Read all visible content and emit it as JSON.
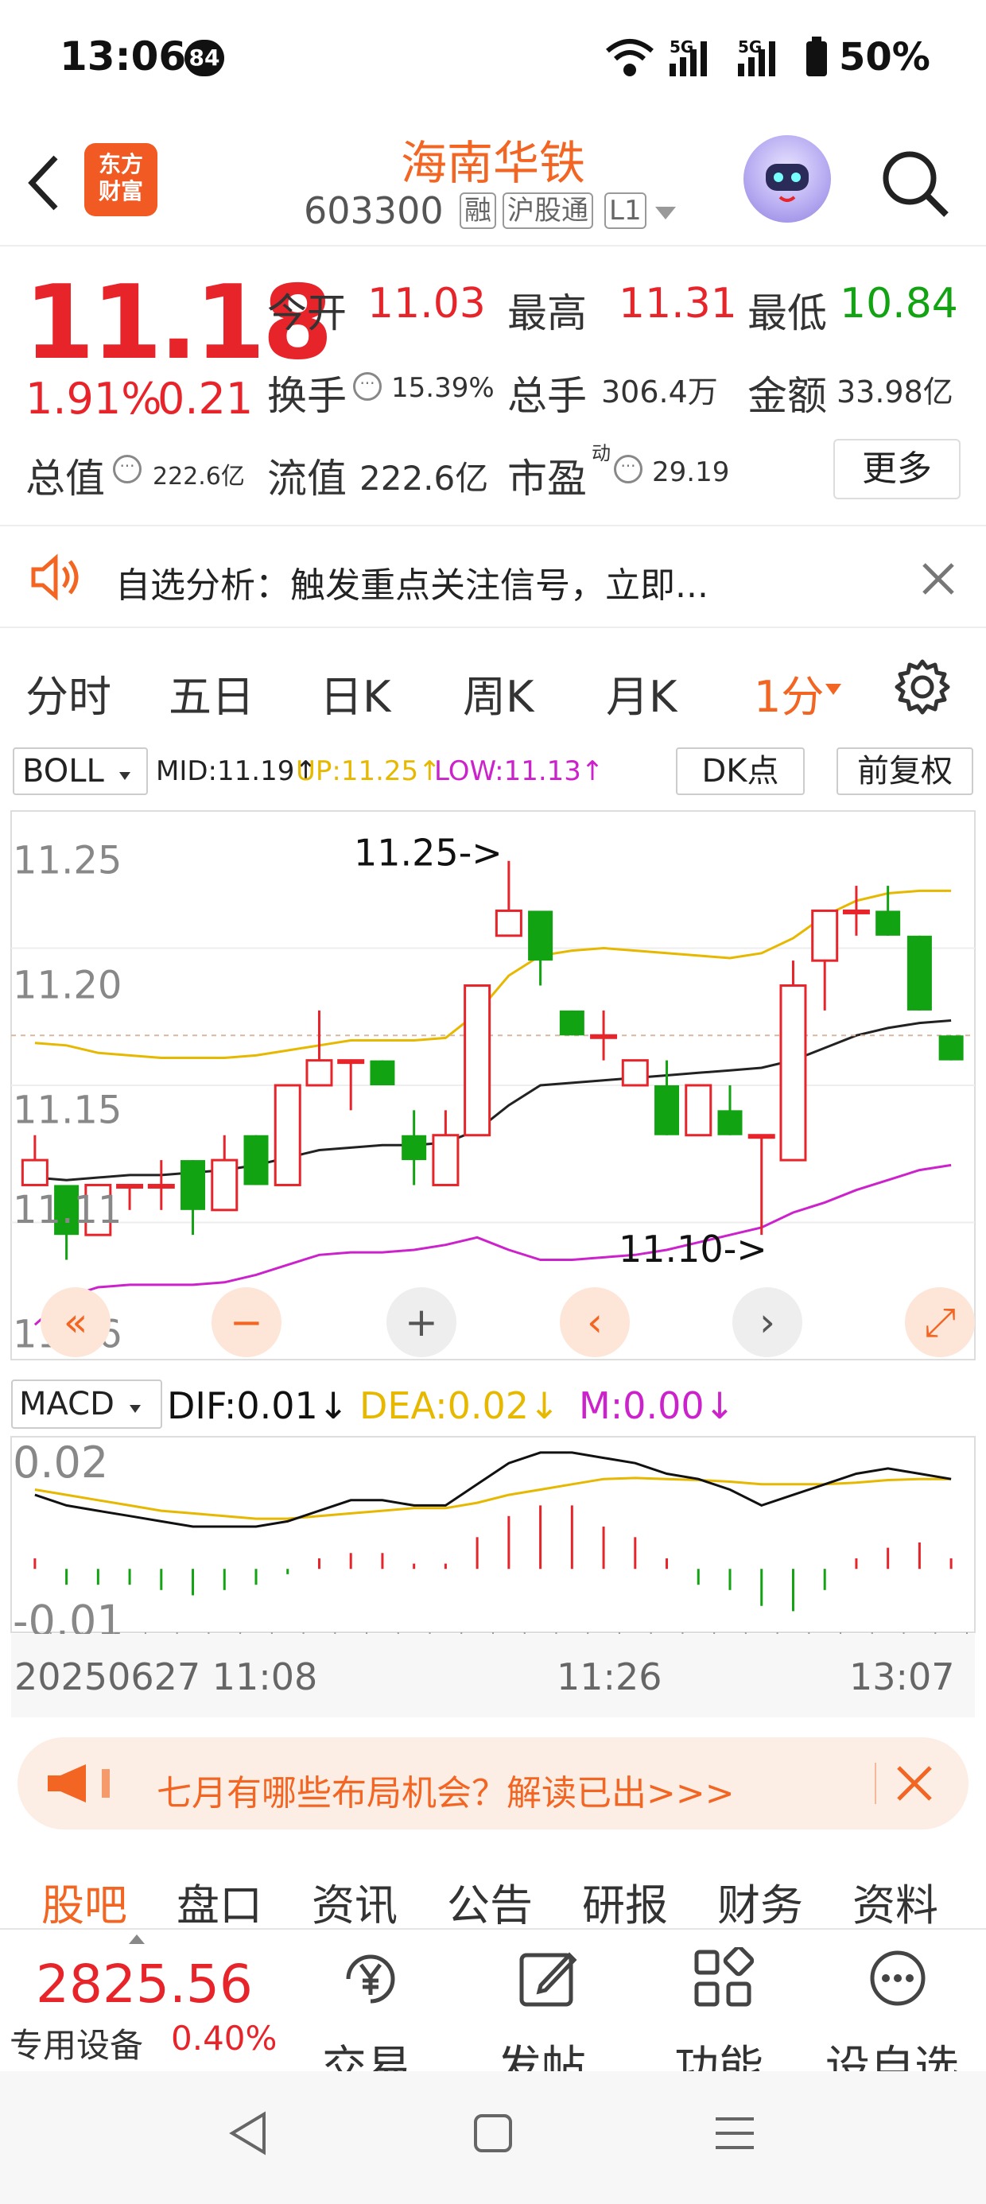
{
  "status_bar": {
    "time": "13:06",
    "notification_count": "84",
    "signal_1": "5G",
    "signal_2": "5G",
    "battery": "50%"
  },
  "header": {
    "logo_line1": "东方",
    "logo_line2": "财富",
    "stock_name": "海南华铁",
    "stock_code": "603300",
    "tags": [
      "融",
      "沪股通",
      "L1"
    ]
  },
  "quote": {
    "price": "11.18",
    "change_pct": "1.91%",
    "change_amt": "0.21",
    "open_label": "今开",
    "open": "11.03",
    "high_label": "最高",
    "high": "11.31",
    "low_label": "最低",
    "low": "10.84",
    "turnover_label": "换手",
    "turnover": "15.39%",
    "volume_label": "总手",
    "volume": "306.4万",
    "amount_label": "金额",
    "amount": "33.98亿",
    "mktcap_label": "总值",
    "mktcap": "222.6亿",
    "float_label": "流值",
    "float_cap": "222.6亿",
    "pe_label": "市盈",
    "pe_sup": "动",
    "pe": "29.19",
    "more_label": "更多"
  },
  "alert": {
    "text": "自选分析：触发重点关注信号，立即..."
  },
  "period_tabs": [
    "分时",
    "五日",
    "日K",
    "周K",
    "月K",
    "1分"
  ],
  "indicator": {
    "name": "BOLL",
    "mid": "MID:11.19↑",
    "up": "UP:11.25↑",
    "low": "LOW:11.13↑",
    "dk_label": "DK点",
    "adj_label": "前复权"
  },
  "chart_data": {
    "type": "candlestick",
    "ylabels": [
      "11.25",
      "11.20",
      "11.15",
      "11.11",
      "11.06"
    ],
    "annotation_high": "11.25->",
    "annotation_low": "11.10->",
    "candles": [
      {
        "o": 11.12,
        "c": 11.13,
        "h": 11.14,
        "l": 11.12
      },
      {
        "o": 11.12,
        "c": 11.1,
        "h": 11.12,
        "l": 11.09
      },
      {
        "o": 11.1,
        "c": 11.12,
        "h": 11.12,
        "l": 11.1
      },
      {
        "o": 11.12,
        "c": 11.12,
        "h": 11.12,
        "l": 11.11
      },
      {
        "o": 11.12,
        "c": 11.12,
        "h": 11.13,
        "l": 11.11
      },
      {
        "o": 11.13,
        "c": 11.11,
        "h": 11.13,
        "l": 11.1
      },
      {
        "o": 11.11,
        "c": 11.13,
        "h": 11.14,
        "l": 11.11
      },
      {
        "o": 11.14,
        "c": 11.12,
        "h": 11.14,
        "l": 11.12
      },
      {
        "o": 11.12,
        "c": 11.16,
        "h": 11.16,
        "l": 11.12
      },
      {
        "o": 11.16,
        "c": 11.17,
        "h": 11.19,
        "l": 11.16
      },
      {
        "o": 11.17,
        "c": 11.17,
        "h": 11.17,
        "l": 11.15
      },
      {
        "o": 11.17,
        "c": 11.16,
        "h": 11.17,
        "l": 11.16
      },
      {
        "o": 11.14,
        "c": 11.13,
        "h": 11.15,
        "l": 11.12
      },
      {
        "o": 11.12,
        "c": 11.14,
        "h": 11.15,
        "l": 11.12
      },
      {
        "o": 11.14,
        "c": 11.2,
        "h": 11.2,
        "l": 11.14
      },
      {
        "o": 11.22,
        "c": 11.23,
        "h": 11.25,
        "l": 11.22
      },
      {
        "o": 11.23,
        "c": 11.21,
        "h": 11.23,
        "l": 11.2
      },
      {
        "o": 11.19,
        "c": 11.18,
        "h": 11.19,
        "l": 11.18
      },
      {
        "o": 11.18,
        "c": 11.18,
        "h": 11.19,
        "l": 11.17
      },
      {
        "o": 11.16,
        "c": 11.17,
        "h": 11.17,
        "l": 11.16
      },
      {
        "o": 11.16,
        "c": 11.14,
        "h": 11.17,
        "l": 11.14
      },
      {
        "o": 11.14,
        "c": 11.16,
        "h": 11.16,
        "l": 11.14
      },
      {
        "o": 11.15,
        "c": 11.14,
        "h": 11.16,
        "l": 11.14
      },
      {
        "o": 11.14,
        "c": 11.14,
        "h": 11.14,
        "l": 11.1
      },
      {
        "o": 11.13,
        "c": 11.2,
        "h": 11.21,
        "l": 11.13
      },
      {
        "o": 11.21,
        "c": 11.23,
        "h": 11.23,
        "l": 11.19
      },
      {
        "o": 11.23,
        "c": 11.23,
        "h": 11.24,
        "l": 11.22
      },
      {
        "o": 11.23,
        "c": 11.22,
        "h": 11.24,
        "l": 11.22
      },
      {
        "o": 11.22,
        "c": 11.19,
        "h": 11.22,
        "l": 11.19
      },
      {
        "o": 11.18,
        "c": 11.17,
        "h": 11.18,
        "l": 11.17
      }
    ],
    "mid_line": [
      11.123,
      11.122,
      11.123,
      11.124,
      11.124,
      11.125,
      11.126,
      11.128,
      11.131,
      11.134,
      11.135,
      11.136,
      11.136,
      11.137,
      11.142,
      11.152,
      11.16,
      11.161,
      11.162,
      11.163,
      11.164,
      11.165,
      11.166,
      11.167,
      11.17,
      11.175,
      11.18,
      11.183,
      11.185,
      11.186
    ],
    "up_line": [
      11.177,
      11.176,
      11.173,
      11.172,
      11.171,
      11.171,
      11.171,
      11.172,
      11.174,
      11.176,
      11.178,
      11.178,
      11.178,
      11.179,
      11.189,
      11.204,
      11.212,
      11.214,
      11.215,
      11.214,
      11.213,
      11.212,
      11.211,
      11.213,
      11.219,
      11.228,
      11.234,
      11.237,
      11.238,
      11.238
    ],
    "low_line": [
      11.064,
      11.075,
      11.079,
      11.08,
      11.08,
      11.08,
      11.081,
      11.084,
      11.088,
      11.092,
      11.093,
      11.093,
      11.094,
      11.096,
      11.099,
      11.094,
      11.09,
      11.09,
      11.091,
      11.092,
      11.094,
      11.097,
      11.1,
      11.103,
      11.109,
      11.113,
      11.118,
      11.122,
      11.126,
      11.128
    ],
    "ylim": [
      11.05,
      11.27
    ]
  },
  "chart_controls": [
    "«",
    "−",
    "+",
    "‹",
    "›",
    "⤢"
  ],
  "macd": {
    "name": "MACD",
    "dif": "DIF:0.01↓",
    "dea": "DEA:0.02↓",
    "m": "M:0.00↓",
    "ylabels": [
      "0.02",
      "-0.01"
    ],
    "dif_line": [
      0.014,
      0.012,
      0.011,
      0.01,
      0.009,
      0.008,
      0.008,
      0.008,
      0.009,
      0.011,
      0.013,
      0.013,
      0.012,
      0.012,
      0.016,
      0.02,
      0.022,
      0.022,
      0.021,
      0.02,
      0.018,
      0.017,
      0.015,
      0.012,
      0.014,
      0.016,
      0.018,
      0.019,
      0.018,
      0.017
    ],
    "dea_line": [
      0.015,
      0.014,
      0.013,
      0.012,
      0.011,
      0.0105,
      0.01,
      0.0095,
      0.0095,
      0.01,
      0.0105,
      0.011,
      0.0115,
      0.0115,
      0.0125,
      0.014,
      0.015,
      0.016,
      0.017,
      0.0172,
      0.017,
      0.0168,
      0.0165,
      0.016,
      0.016,
      0.016,
      0.0163,
      0.0168,
      0.017,
      0.017
    ],
    "hist": [
      0.002,
      -0.003,
      -0.003,
      -0.003,
      -0.004,
      -0.005,
      -0.004,
      -0.003,
      -0.001,
      0.002,
      0.003,
      0.003,
      0.001,
      0.001,
      0.006,
      0.01,
      0.012,
      0.012,
      0.008,
      0.006,
      0.002,
      -0.003,
      -0.004,
      -0.007,
      -0.008,
      -0.004,
      0.002,
      0.004,
      0.005,
      0.002
    ],
    "ylim": [
      -0.012,
      0.025
    ]
  },
  "time_axis": {
    "start": "20250627 11:08",
    "mid": "11:26",
    "end": "13:07"
  },
  "promo": {
    "text": "七月有哪些布局机会？解读已出>>>"
  },
  "bottom_tabs": [
    "股吧",
    "盘口",
    "资讯",
    "公告",
    "研报",
    "财务",
    "资料"
  ],
  "dock": {
    "index": "2825.56",
    "sector": "专用设备",
    "sector_pct": "0.40%",
    "items": [
      "交易",
      "发帖",
      "功能",
      "设自选"
    ]
  },
  "colors": {
    "red": "#e8242b",
    "green": "#12a312",
    "orange": "#f26522",
    "mid": "#222222",
    "up": "#e6b800",
    "low": "#cc22cc"
  }
}
